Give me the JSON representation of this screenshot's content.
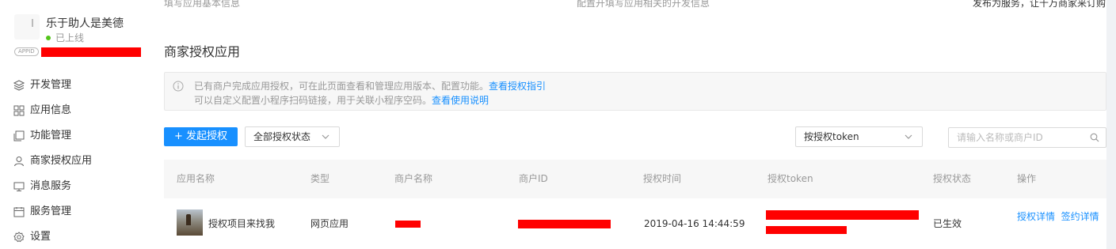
{
  "app": {
    "name": "乐于助人是美德",
    "status": "已上线",
    "appid_tag": "APPID"
  },
  "nav": {
    "items": [
      {
        "label": "开发管理",
        "icon": "layers-icon"
      },
      {
        "label": "应用信息",
        "icon": "grid-icon"
      },
      {
        "label": "功能管理",
        "icon": "copy-icon"
      },
      {
        "label": "商家授权应用",
        "icon": "user-icon"
      },
      {
        "label": "消息服务",
        "icon": "monitor-icon"
      },
      {
        "label": "服务管理",
        "icon": "calendar-icon"
      },
      {
        "label": "设置",
        "icon": "gear-icon"
      }
    ]
  },
  "top_cut": {
    "left": "填写应用基本信息",
    "middle": "配置开填写应用相关的开发信息",
    "right": "发布为服务，让千万商家来订购"
  },
  "section": {
    "title": "商家授权应用"
  },
  "notice": {
    "line1": "已有商户完成应用授权，可在此页面查看和管理应用版本、配置功能。",
    "line1_link": "查看授权指引",
    "line2": "可以自定义配置小程序扫码链接，用于关联小程序空码。",
    "line2_link": "查看使用说明"
  },
  "toolbar": {
    "authorize_button": "发起授权",
    "status_filter": "全部授权状态",
    "type_filter": "按授权token",
    "search_placeholder": "请输入名称或商户ID"
  },
  "table": {
    "headers": [
      "应用名称",
      "类型",
      "商户名称",
      "商户ID",
      "授权时间",
      "授权token",
      "授权状态",
      "操作"
    ],
    "rows": [
      {
        "app_name": "授权项目来找我",
        "type": "网页应用",
        "auth_time": "2019-04-16 14:44:59",
        "status": "已生效",
        "op_detail": "授权详情",
        "op_sign": "签约详情"
      }
    ]
  },
  "colors": {
    "primary": "#1890ff",
    "redaction": "#ff0000",
    "online": "#52c41a"
  }
}
